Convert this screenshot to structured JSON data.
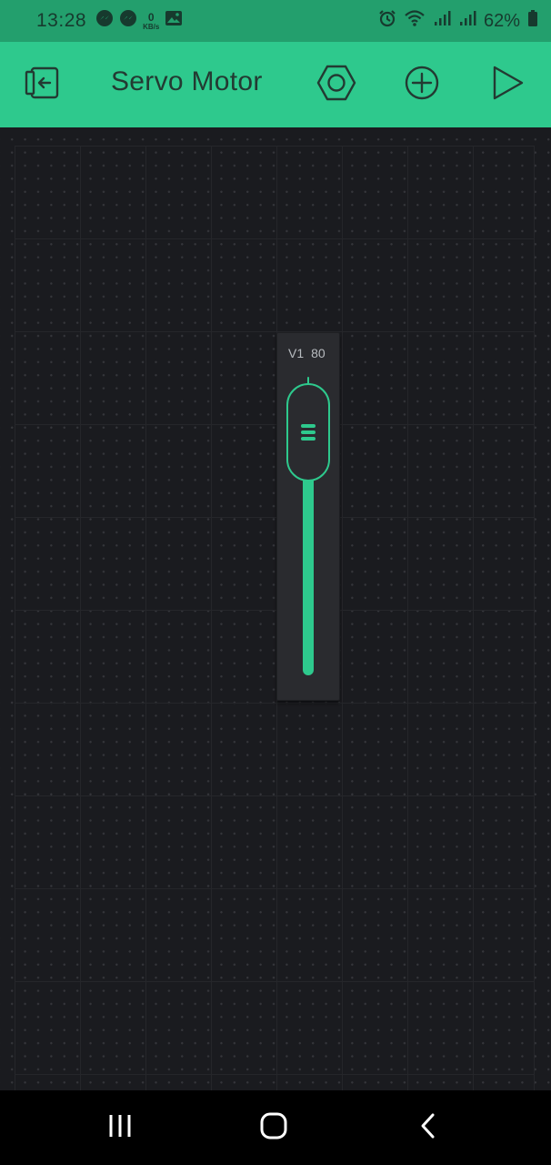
{
  "status_bar": {
    "time": "13:28",
    "left_icons": [
      "messenger-icon",
      "messenger-icon",
      "net-speed",
      "gallery-icon"
    ],
    "net_speed_value": "0",
    "net_speed_unit": "KB/s",
    "right_icons": [
      "alarm-icon",
      "wifi-icon",
      "signal-icon",
      "signal-icon",
      "battery-icon"
    ],
    "battery": "62%"
  },
  "header": {
    "title": "Servo Motor",
    "buttons": [
      "exit-icon",
      "settings-hex-icon",
      "add-circle-icon",
      "play-icon"
    ]
  },
  "slider": {
    "pin": "V1",
    "value": "80",
    "fraction": 0.8,
    "color": "#2ec98d"
  },
  "nav": {
    "buttons": [
      "recents-icon",
      "home-icon",
      "back-icon"
    ]
  },
  "colors": {
    "accent": "#2ec98d",
    "status_bar": "#239f6d",
    "canvas": "#1a1b1f"
  }
}
